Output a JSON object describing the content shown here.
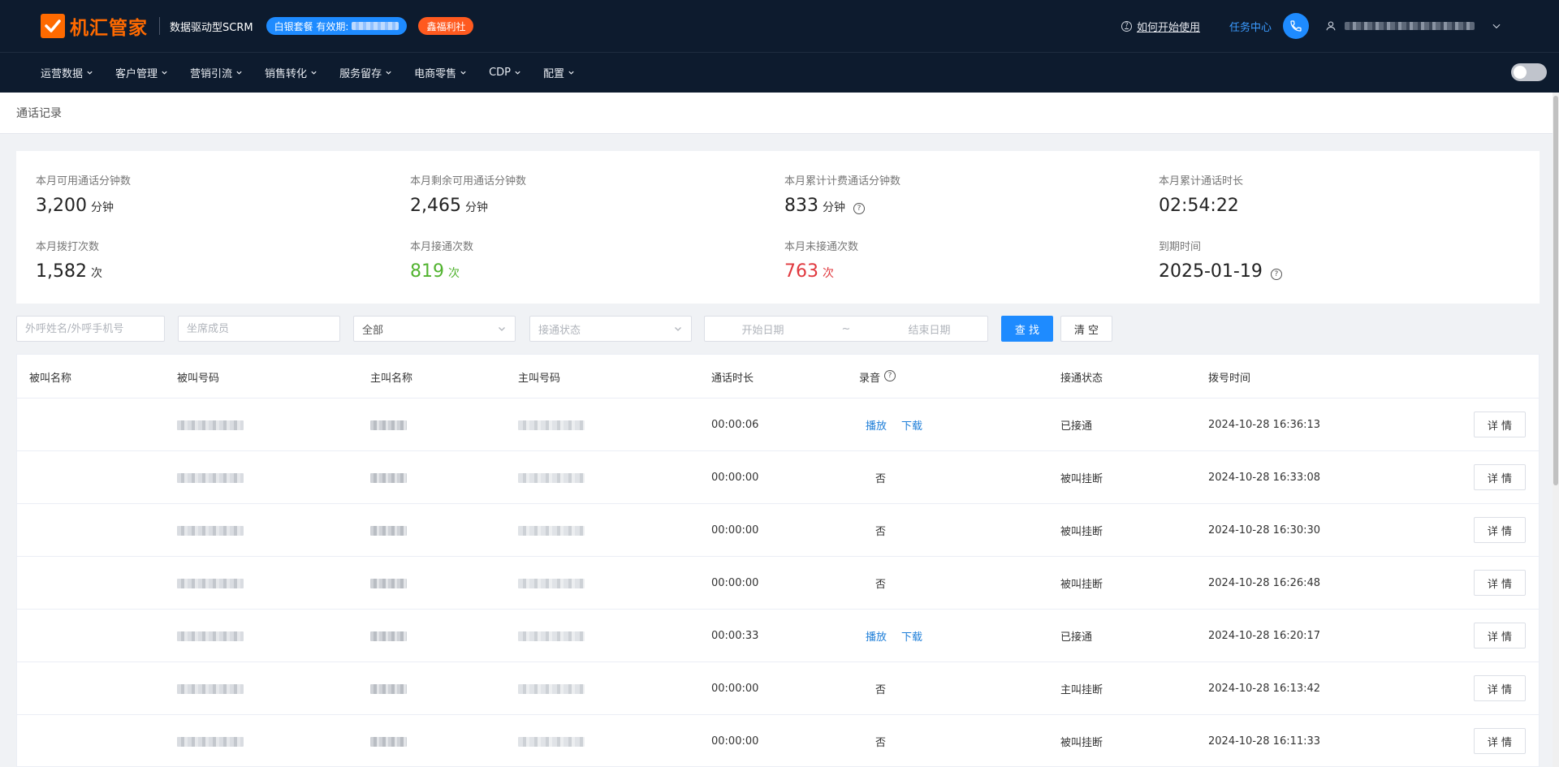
{
  "header": {
    "brand": "机汇管家",
    "subtitle": "数据驱动型SCRM",
    "package_label": "白银套餐 有效期:",
    "welfare_label": "鑫福利社",
    "help_label": "如何开始使用",
    "task_center": "任务中心"
  },
  "nav": {
    "items": [
      "运营数据",
      "客户管理",
      "营销引流",
      "销售转化",
      "服务留存",
      "电商零售",
      "CDP",
      "配置"
    ]
  },
  "breadcrumb": "通话记录",
  "stats": {
    "available_label": "本月可用通话分钟数",
    "available_value": "3,200",
    "available_unit": "分钟",
    "remaining_label": "本月剩余可用通话分钟数",
    "remaining_value": "2,465",
    "remaining_unit": "分钟",
    "billed_label": "本月累计计费通话分钟数",
    "billed_value": "833",
    "billed_unit": "分钟",
    "duration_label": "本月累计通话时长",
    "duration_value": "02:54:22",
    "dialed_label": "本月拨打次数",
    "dialed_value": "1,582",
    "dialed_unit": "次",
    "connected_label": "本月接通次数",
    "connected_value": "819",
    "connected_unit": "次",
    "unconnected_label": "本月未接通次数",
    "unconnected_value": "763",
    "unconnected_unit": "次",
    "expire_label": "到期时间",
    "expire_value": "2025-01-19"
  },
  "filters": {
    "callee_placeholder": "外呼姓名/外呼手机号",
    "agent_placeholder": "坐席成员",
    "scope_value": "全部",
    "status_placeholder": "接通状态",
    "start_placeholder": "开始日期",
    "range_sep": "~",
    "end_placeholder": "结束日期",
    "search_label": "查 找",
    "clear_label": "清 空"
  },
  "table": {
    "headers": [
      "被叫名称",
      "被叫号码",
      "主叫名称",
      "主叫号码",
      "通话时长",
      "录音",
      "接通状态",
      "拨号时间"
    ],
    "play_label": "播放",
    "download_label": "下载",
    "detail_label": "详 情",
    "rows": [
      {
        "duration": "00:00:06",
        "recording": "",
        "status": "已接通",
        "time": "2024-10-28 16:36:13"
      },
      {
        "duration": "00:00:00",
        "recording": "否",
        "status": "被叫挂断",
        "time": "2024-10-28 16:33:08"
      },
      {
        "duration": "00:00:00",
        "recording": "否",
        "status": "被叫挂断",
        "time": "2024-10-28 16:30:30"
      },
      {
        "duration": "00:00:00",
        "recording": "否",
        "status": "被叫挂断",
        "time": "2024-10-28 16:26:48"
      },
      {
        "duration": "00:00:33",
        "recording": "",
        "status": "已接通",
        "time": "2024-10-28 16:20:17"
      },
      {
        "duration": "00:00:00",
        "recording": "否",
        "status": "主叫挂断",
        "time": "2024-10-28 16:13:42"
      },
      {
        "duration": "00:00:00",
        "recording": "否",
        "status": "被叫挂断",
        "time": "2024-10-28 16:11:33"
      }
    ]
  },
  "colors": {
    "header_bg": "#0d1b2e",
    "brand": "#ff6a00",
    "primary": "#1e8bff",
    "connected_green": "#52b330",
    "unconnected_red": "#e0383e",
    "link_blue": "#1e7ed8"
  },
  "icons": {
    "logo": "logo-check-icon",
    "help": "question-circle-icon",
    "phone": "phone-icon",
    "user": "user-icon",
    "dropdown": "chevron-down-icon"
  }
}
